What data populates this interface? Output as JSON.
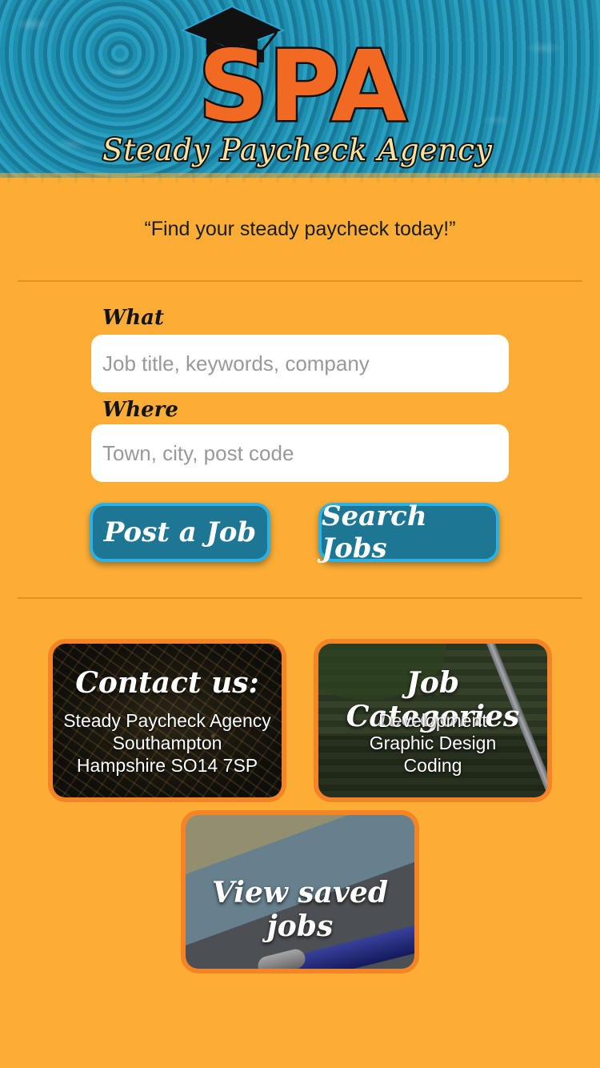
{
  "header": {
    "logo_title": "SPA",
    "logo_subtitle": "Steady Paycheck Agency"
  },
  "tagline": "“Find your steady paycheck today!”",
  "search": {
    "what_label": "What",
    "what_placeholder": "Job title, keywords, company",
    "where_label": "Where",
    "where_placeholder": "Town, city, post code"
  },
  "buttons": {
    "post_job": "Post a Job",
    "search_jobs": "Search Jobs"
  },
  "cards": {
    "contact": {
      "title": "Contact us:",
      "lines": [
        "Steady Paycheck Agency",
        "Southampton",
        "Hampshire SO14 7SP"
      ]
    },
    "categories": {
      "title": "Job Categories",
      "lines": [
        "Development",
        "Graphic Design",
        "Coding"
      ]
    },
    "saved": {
      "title": "View saved jobs"
    }
  },
  "colors": {
    "background": "#fbad36",
    "button": "#1c7694",
    "button_border": "#2bb1e3",
    "card_border": "#f58426",
    "logo_orange": "#f26a21"
  },
  "icons": {
    "logo_cap": "graduation-cap-icon"
  }
}
